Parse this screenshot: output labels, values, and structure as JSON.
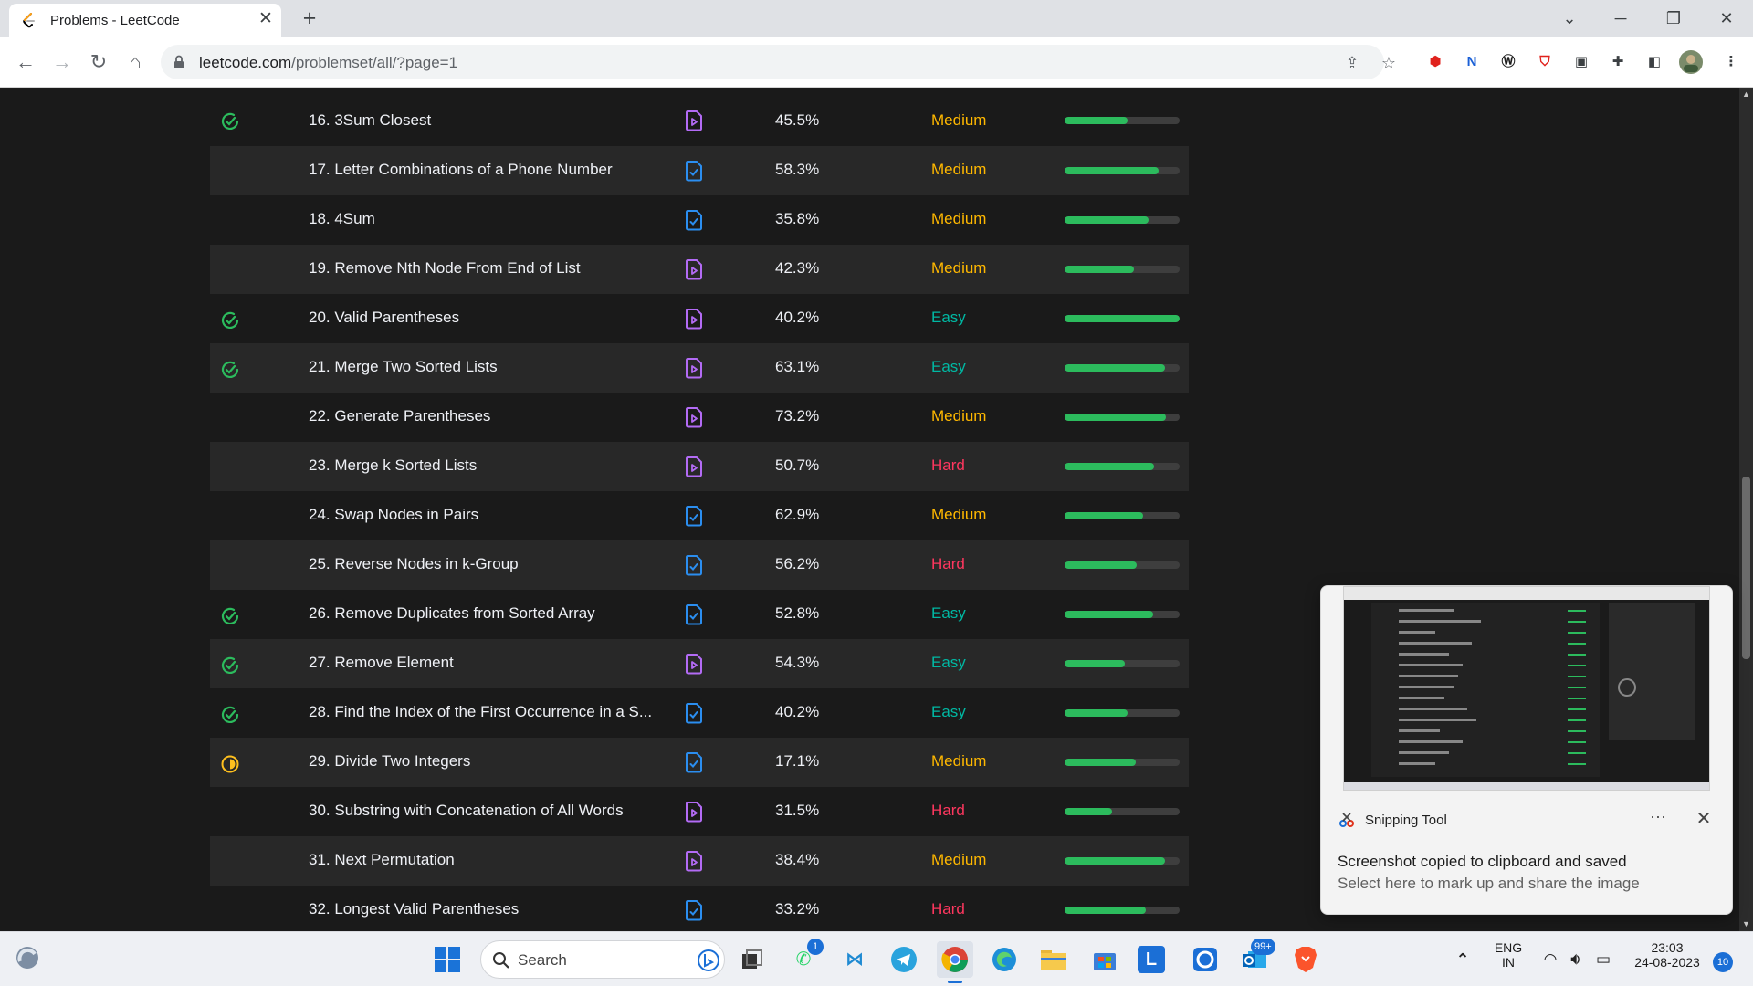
{
  "browser": {
    "tab_title": "Problems - LeetCode",
    "url_host": "leetcode.com",
    "url_path": "/problemset/all/?page=1"
  },
  "problems": [
    {
      "title": "16. 3Sum Closest",
      "solved": "solved",
      "solution_color": "#b36bf5",
      "acceptance": "45.5%",
      "difficulty": "Medium",
      "frequency": 0.55
    },
    {
      "title": "17. Letter Combinations of a Phone Number",
      "solved": "",
      "solution_color": "#2b8ef0",
      "acceptance": "58.3%",
      "difficulty": "Medium",
      "frequency": 0.82
    },
    {
      "title": "18. 4Sum",
      "solved": "",
      "solution_color": "#2b8ef0",
      "acceptance": "35.8%",
      "difficulty": "Medium",
      "frequency": 0.73
    },
    {
      "title": "19. Remove Nth Node From End of List",
      "solved": "",
      "solution_color": "#b36bf5",
      "acceptance": "42.3%",
      "difficulty": "Medium",
      "frequency": 0.6
    },
    {
      "title": "20. Valid Parentheses",
      "solved": "solved",
      "solution_color": "#b36bf5",
      "acceptance": "40.2%",
      "difficulty": "Easy",
      "frequency": 1.0
    },
    {
      "title": "21. Merge Two Sorted Lists",
      "solved": "solved",
      "solution_color": "#b36bf5",
      "acceptance": "63.1%",
      "difficulty": "Easy",
      "frequency": 0.87
    },
    {
      "title": "22. Generate Parentheses",
      "solved": "",
      "solution_color": "#b36bf5",
      "acceptance": "73.2%",
      "difficulty": "Medium",
      "frequency": 0.88
    },
    {
      "title": "23. Merge k Sorted Lists",
      "solved": "",
      "solution_color": "#b36bf5",
      "acceptance": "50.7%",
      "difficulty": "Hard",
      "frequency": 0.78
    },
    {
      "title": "24. Swap Nodes in Pairs",
      "solved": "",
      "solution_color": "#2b8ef0",
      "acceptance": "62.9%",
      "difficulty": "Medium",
      "frequency": 0.68
    },
    {
      "title": "25. Reverse Nodes in k-Group",
      "solved": "",
      "solution_color": "#2b8ef0",
      "acceptance": "56.2%",
      "difficulty": "Hard",
      "frequency": 0.63
    },
    {
      "title": "26. Remove Duplicates from Sorted Array",
      "solved": "solved",
      "solution_color": "#2b8ef0",
      "acceptance": "52.8%",
      "difficulty": "Easy",
      "frequency": 0.77
    },
    {
      "title": "27. Remove Element",
      "solved": "solved",
      "solution_color": "#b36bf5",
      "acceptance": "54.3%",
      "difficulty": "Easy",
      "frequency": 0.52
    },
    {
      "title": "28. Find the Index of the First Occurrence in a S...",
      "solved": "solved",
      "solution_color": "#2b8ef0",
      "acceptance": "40.2%",
      "difficulty": "Easy",
      "frequency": 0.55
    },
    {
      "title": "29. Divide Two Integers",
      "solved": "attempted",
      "solution_color": "#2b8ef0",
      "acceptance": "17.1%",
      "difficulty": "Medium",
      "frequency": 0.62
    },
    {
      "title": "30. Substring with Concatenation of All Words",
      "solved": "",
      "solution_color": "#b36bf5",
      "acceptance": "31.5%",
      "difficulty": "Hard",
      "frequency": 0.41
    },
    {
      "title": "31. Next Permutation",
      "solved": "",
      "solution_color": "#b36bf5",
      "acceptance": "38.4%",
      "difficulty": "Medium",
      "frequency": 0.87
    },
    {
      "title": "32. Longest Valid Parentheses",
      "solved": "",
      "solution_color": "#2b8ef0",
      "acceptance": "33.2%",
      "difficulty": "Hard",
      "frequency": 0.71
    }
  ],
  "toast": {
    "app_name": "Snipping Tool",
    "title": "Screenshot copied to clipboard and saved",
    "message": "Select here to mark up and share the image"
  },
  "taskbar": {
    "search_label": "Search",
    "whatsapp_badge": "1",
    "outlook_badge": "99+",
    "language": "ENG",
    "region": "IN",
    "time": "23:03",
    "date": "24-08-2023",
    "notification_count": "10"
  }
}
